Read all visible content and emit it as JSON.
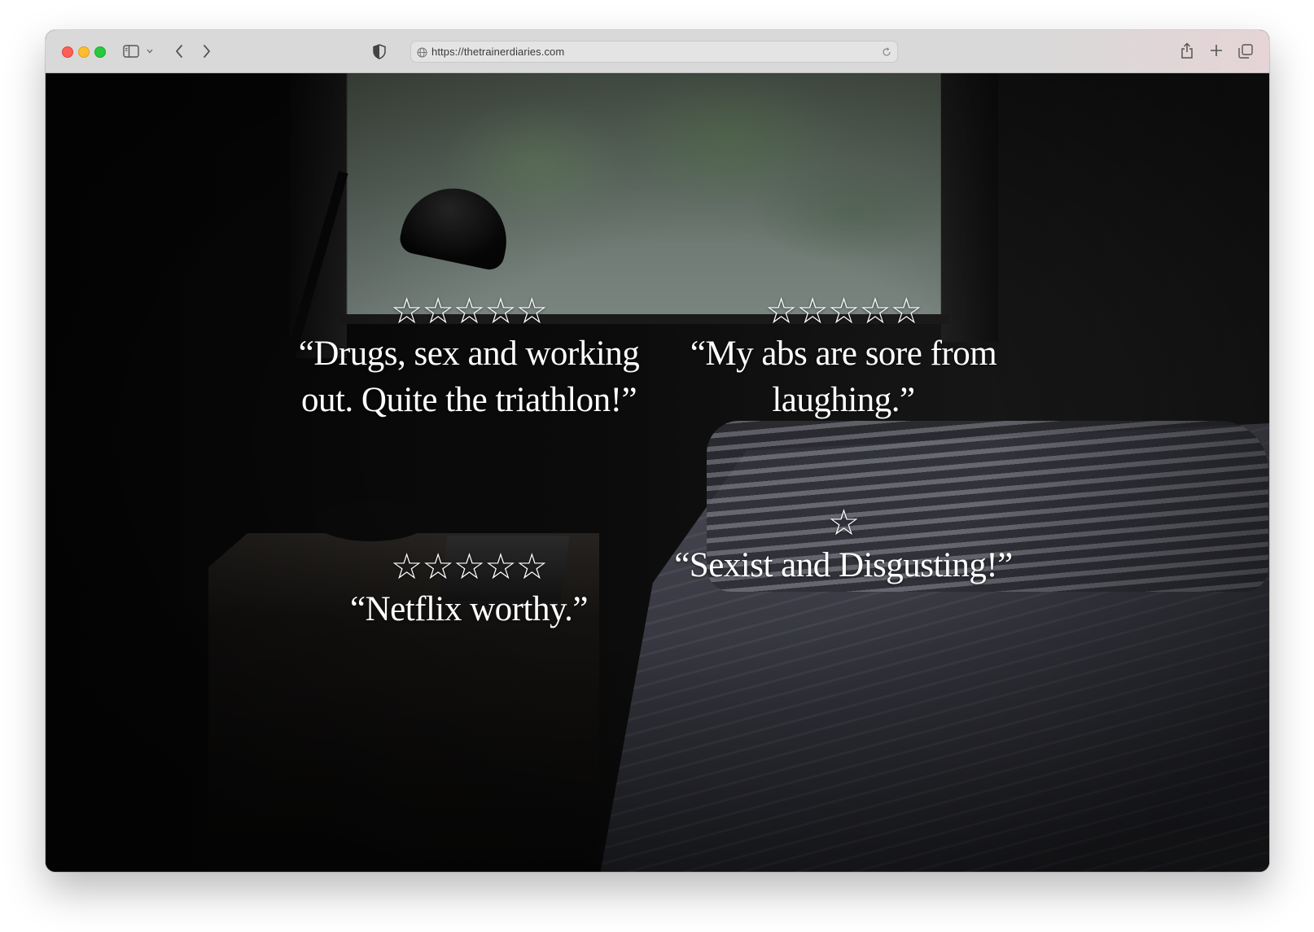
{
  "browser": {
    "url": "https://thetrainerdiaries.com",
    "icons": [
      "close-dot",
      "minimize-dot",
      "maximize-dot",
      "sidebar-icon",
      "chevron-down-icon",
      "back-arrow-icon",
      "forward-arrow-icon",
      "privacy-shield-icon",
      "globe-icon",
      "reload-icon",
      "share-icon",
      "new-tab-plus-icon",
      "tab-overview-icon"
    ]
  },
  "reviews": [
    {
      "stars": "☆☆☆☆☆",
      "quote": "“Drugs, sex and working out. Quite the triathlon!”"
    },
    {
      "stars": "☆☆☆☆☆",
      "quote": "“My abs are sore from laughing.”"
    },
    {
      "stars": "☆☆☆☆☆",
      "quote": "“Netflix worthy.”"
    },
    {
      "stars": "☆",
      "quote": "“Sexist and Disgusting!”"
    }
  ]
}
